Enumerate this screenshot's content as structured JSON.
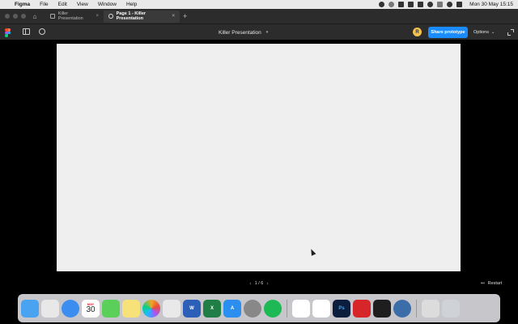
{
  "menubar": {
    "app_name": "Figma",
    "items": [
      "File",
      "Edit",
      "View",
      "Window",
      "Help"
    ],
    "clock": "Mon 30 May  15:15"
  },
  "tabs": [
    {
      "label": "Killer Presentation",
      "active": false
    },
    {
      "label": "Page 1 - Killer Presentation",
      "active": true
    }
  ],
  "toolbar": {
    "title": "Killer Presentation",
    "avatar_initial": "R",
    "share_label": "Share prototype",
    "options_label": "Options"
  },
  "player": {
    "pager": "1 / 6",
    "restart_label": "Restart"
  },
  "dock": {
    "calendar_month": "MAY",
    "calendar_day": "30",
    "apps": [
      {
        "name": "finder",
        "color": "#4aa3f0"
      },
      {
        "name": "launchpad",
        "color": "#e8e8e8"
      },
      {
        "name": "safari",
        "color": "#3b8ef0"
      },
      {
        "name": "calendar",
        "color": "#ffffff"
      },
      {
        "name": "messages",
        "color": "#5ad05a"
      },
      {
        "name": "notes",
        "color": "#f7e27a"
      },
      {
        "name": "photos",
        "color": "#f5a623"
      },
      {
        "name": "preview",
        "color": "#e9e9e9"
      },
      {
        "name": "word",
        "color": "#2b5fb8"
      },
      {
        "name": "excel",
        "color": "#1e7e45"
      },
      {
        "name": "app-store",
        "color": "#2c8ff0"
      },
      {
        "name": "system-preferences",
        "color": "#888888"
      },
      {
        "name": "spotify",
        "color": "#1db954"
      },
      {
        "name": "slack",
        "color": "#ffffff"
      },
      {
        "name": "asana",
        "color": "#ffffff"
      },
      {
        "name": "photoshop",
        "color": "#0b1e3d"
      },
      {
        "name": "acrobat",
        "color": "#d7262a"
      },
      {
        "name": "figma",
        "color": "#1e1e1e"
      },
      {
        "name": "quicktime",
        "color": "#3b6ea8"
      },
      {
        "name": "keyboard-viewer",
        "color": "#dcdcdc"
      },
      {
        "name": "trash",
        "color": "#cfd2d6"
      }
    ]
  }
}
